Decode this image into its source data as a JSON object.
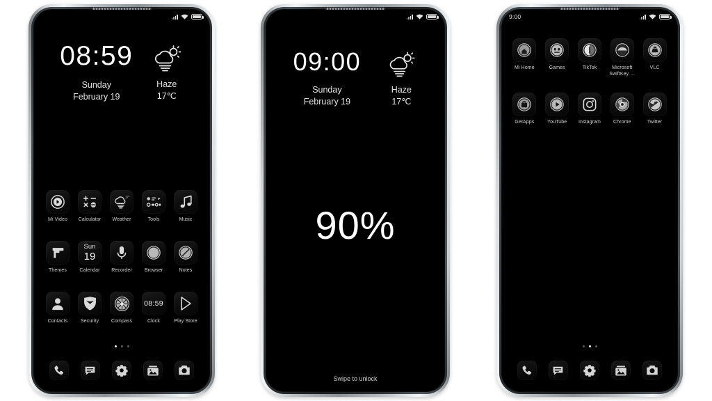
{
  "scene": {
    "background": "#ffffff",
    "description": "Three smartphone mockups showing a dark MIUI theme"
  },
  "phones": [
    {
      "id": "phone-home-1",
      "status_bar": {
        "time": "",
        "icons": [
          "signal-icon",
          "wifi-icon",
          "battery-icon"
        ]
      },
      "widget": {
        "clock": "08:59",
        "day": "Sunday",
        "date": "February 19",
        "weather_condition": "Haze",
        "weather_temp": "17℃",
        "weather_icon": "sun-behind-cloud-haze-icon",
        "weather_badge": "17°"
      },
      "app_rows": [
        [
          {
            "label": "Mi Video",
            "icon": "play-circle-icon"
          },
          {
            "label": "Calculator",
            "icon": "calculator-icon"
          },
          {
            "label": "Weather",
            "icon": "cloud-haze-icon"
          },
          {
            "label": "Tools",
            "icon": "tools-folder-icon"
          },
          {
            "label": "Music",
            "icon": "music-note-icon"
          }
        ],
        [
          {
            "label": "Themes",
            "icon": "paint-roller-icon"
          },
          {
            "label": "Calendar",
            "icon": "calendar-icon",
            "day_name": "Sun",
            "day_num": "19"
          },
          {
            "label": "Recorder",
            "icon": "microphone-icon"
          },
          {
            "label": "Browser",
            "icon": "browser-circle-icon"
          },
          {
            "label": "Notes",
            "icon": "notes-circle-icon"
          }
        ],
        [
          {
            "label": "Contacts",
            "icon": "person-icon"
          },
          {
            "label": "Security",
            "icon": "shield-icon"
          },
          {
            "label": "Compass",
            "icon": "compass-icon"
          },
          {
            "label": "Clock",
            "icon": "clock-digits-icon",
            "digits": "08:59"
          },
          {
            "label": "Play Store",
            "icon": "play-store-icon"
          }
        ]
      ],
      "page_dots": {
        "count": 3,
        "active": 0
      },
      "dock": [
        {
          "label": "Phone",
          "icon": "phone-handset-icon"
        },
        {
          "label": "Messages",
          "icon": "message-bubble-icon"
        },
        {
          "label": "Settings",
          "icon": "gear-icon"
        },
        {
          "label": "Gallery",
          "icon": "photo-stack-icon"
        },
        {
          "label": "Camera",
          "icon": "camera-icon"
        }
      ]
    },
    {
      "id": "phone-lock-2",
      "status_bar": {
        "time": "",
        "icons": [
          "signal-icon",
          "wifi-icon",
          "battery-icon"
        ]
      },
      "widget": {
        "clock": "09:00",
        "day": "Sunday",
        "date": "February 19",
        "weather_condition": "Haze",
        "weather_temp": "17℃",
        "weather_icon": "sun-behind-cloud-haze-icon"
      },
      "battery_percent": "90%",
      "hint": "Swipe to unlock"
    },
    {
      "id": "phone-home-3",
      "status_bar": {
        "time": "9:00",
        "icons": [
          "signal-icon",
          "wifi-icon",
          "battery-icon"
        ]
      },
      "app_rows": [
        [
          {
            "label": "Mi Home",
            "icon": "mi-home-icon"
          },
          {
            "label": "Games",
            "icon": "games-face-icon"
          },
          {
            "label": "TikTok",
            "icon": "tiktok-icon"
          },
          {
            "label": "Microsoft SwiftKey …",
            "icon": "swiftkey-icon"
          },
          {
            "label": "VLC",
            "icon": "vlc-cone-icon"
          }
        ],
        [
          {
            "label": "GetApps",
            "icon": "getapps-bag-icon"
          },
          {
            "label": "YouTube",
            "icon": "youtube-play-icon"
          },
          {
            "label": "Instagram",
            "icon": "instagram-camera-icon"
          },
          {
            "label": "Chrome",
            "icon": "chrome-icon"
          },
          {
            "label": "Twitter",
            "icon": "twitter-bird-icon"
          }
        ]
      ],
      "page_dots": {
        "count": 3,
        "active": 1
      },
      "dock": [
        {
          "label": "Phone",
          "icon": "phone-handset-icon"
        },
        {
          "label": "Messages",
          "icon": "message-bubble-icon"
        },
        {
          "label": "Settings",
          "icon": "gear-icon"
        },
        {
          "label": "Gallery",
          "icon": "photo-stack-icon"
        },
        {
          "label": "Camera",
          "icon": "camera-icon"
        }
      ]
    }
  ],
  "colors": {
    "screen_bg": "#000000",
    "icon_fg": "#d9d9d9",
    "label_fg": "#d4d4d4",
    "page_bg": "#ffffff"
  }
}
